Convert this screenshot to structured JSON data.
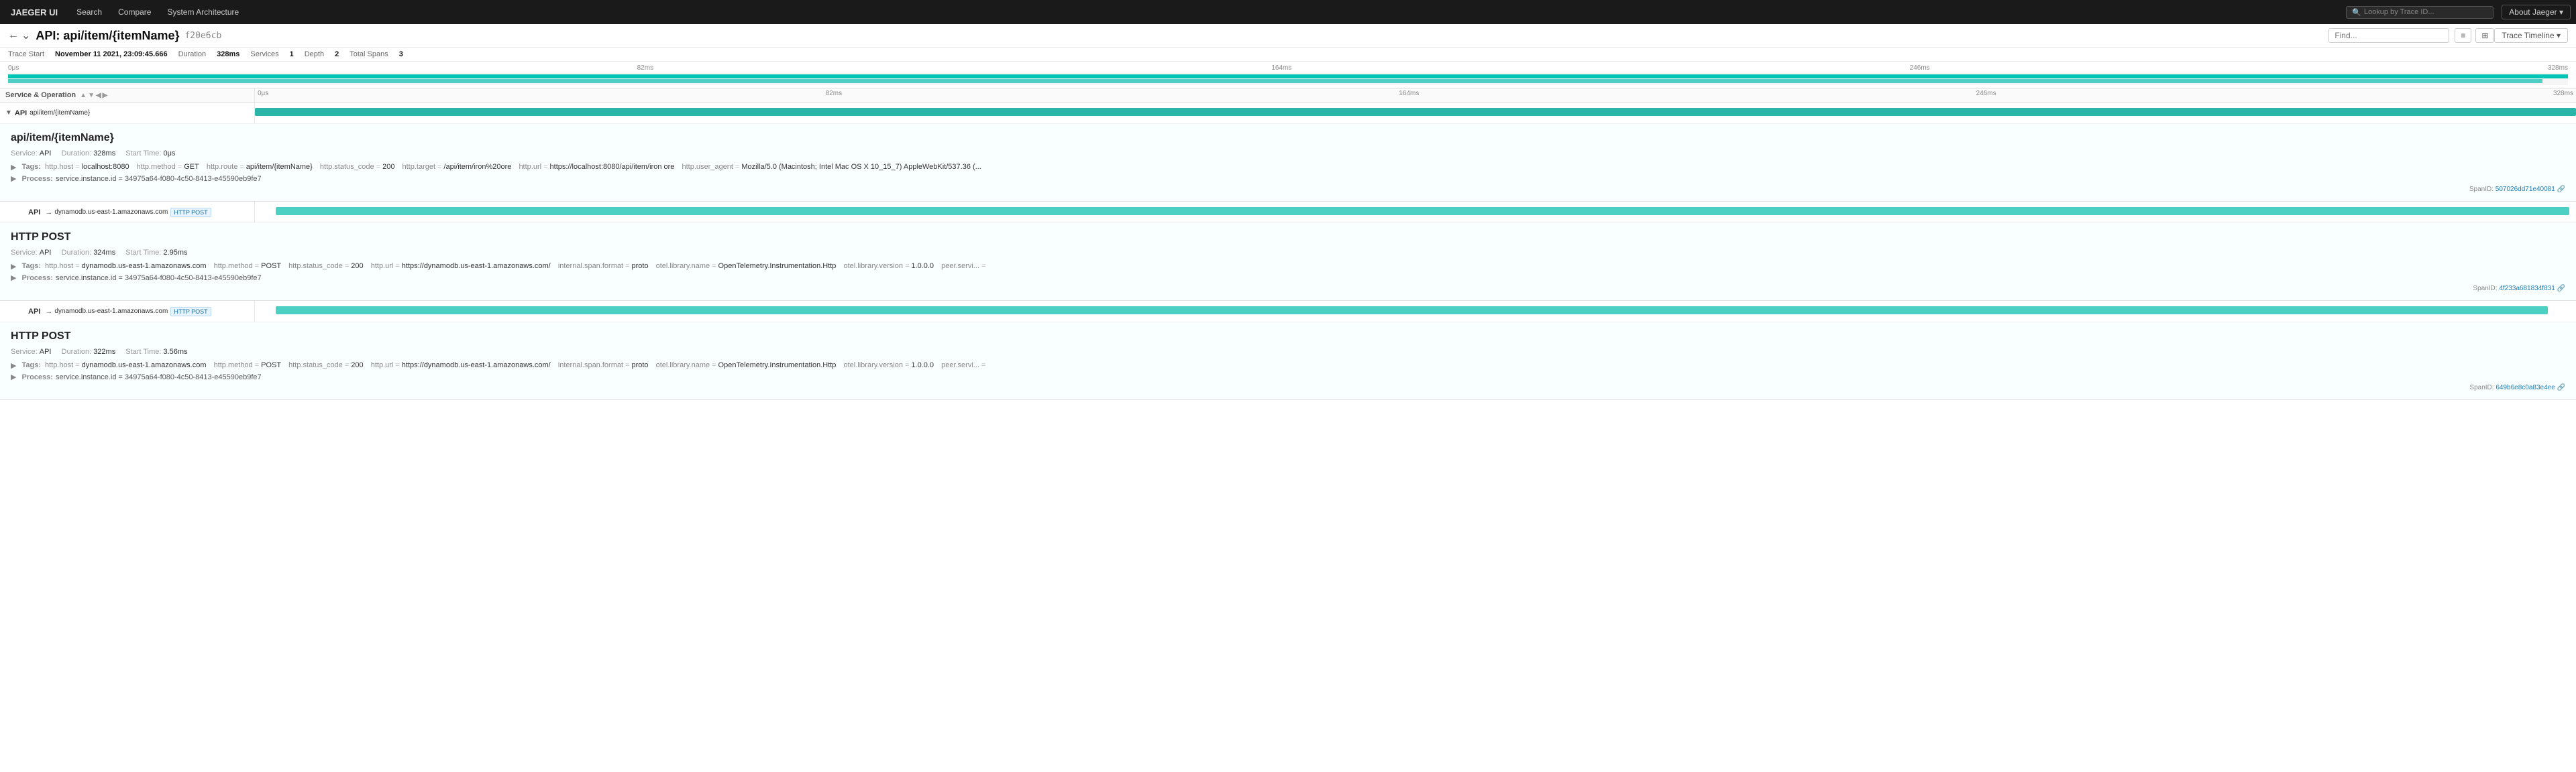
{
  "nav": {
    "logo": "JAEGER UI",
    "buttons": [
      "Search",
      "Compare",
      "System Architecture"
    ],
    "active": "Search",
    "lookup_placeholder": "Lookup by Trace ID...",
    "about_label": "About Jaeger ▾"
  },
  "trace_header": {
    "title": "API: api/item/{itemName}",
    "trace_id": "f20e6cb",
    "find_placeholder": "Find...",
    "timeline_label": "Trace Timeline ▾"
  },
  "trace_meta": {
    "trace_start_label": "Trace Start",
    "trace_start_value": "November 11 2021, 23:09:45.666",
    "duration_label": "Duration",
    "duration_value": "328ms",
    "services_label": "Services",
    "services_value": "1",
    "depth_label": "Depth",
    "depth_value": "2",
    "total_spans_label": "Total Spans",
    "total_spans_value": "3"
  },
  "ruler": {
    "ticks": [
      "0μs",
      "82ms",
      "164ms",
      "246ms",
      "328ms"
    ]
  },
  "column_header": {
    "service_label": "Service & Operation"
  },
  "spans": [
    {
      "id": "span-1",
      "indent": 0,
      "service": "API",
      "operation": "api/item/{itemName}",
      "has_children": true,
      "expanded": true,
      "bar_left_pct": 0,
      "bar_width_pct": 100,
      "is_root": true,
      "detail": {
        "title": "api/item/{itemName}",
        "service_label": "Service:",
        "service_value": "API",
        "duration_label": "Duration:",
        "duration_value": "328ms",
        "start_time_label": "Start Time:",
        "start_time_value": "0μs",
        "tags_label": "Tags:",
        "tags": [
          {
            "key": "http.host",
            "val": "localhost:8080"
          },
          {
            "key": "http.method",
            "val": "GET"
          },
          {
            "key": "http.route",
            "val": "api/item/{itemName}"
          },
          {
            "key": "http.status_code",
            "val": "200"
          },
          {
            "key": "http.target",
            "val": "/api/item/iron%20ore"
          },
          {
            "key": "http.url",
            "val": "https://localhost:8080/api/item/iron ore"
          },
          {
            "key": "http.user_agent",
            "val": "Mozilla/5.0 (Macintosh; Intel Mac OS X 10_15_7) AppleWebKit/537.36 (..."
          }
        ],
        "process_label": "Process:",
        "process_value": "service.instance.id = 34975a64-f080-4c50-8413-e45590eb9fe7",
        "span_id_label": "SpanID:",
        "span_id_value": "507026dd71e40081"
      }
    },
    {
      "id": "span-2",
      "indent": 1,
      "service": "API",
      "arrow": "→",
      "dest": "dynamodb.us-east-1.amazonaws.com",
      "http_badge": "HTTP POST",
      "bar_left_pct": 0.9,
      "bar_width_pct": 98.8,
      "is_root": false,
      "detail": {
        "title": "HTTP POST",
        "service_label": "Service:",
        "service_value": "API",
        "duration_label": "Duration:",
        "duration_value": "324ms",
        "start_time_label": "Start Time:",
        "start_time_value": "2.95ms",
        "tags_label": "Tags:",
        "tags": [
          {
            "key": "http.host",
            "val": "dynamodb.us-east-1.amazonaws.com"
          },
          {
            "key": "http.method",
            "val": "POST"
          },
          {
            "key": "http.status_code",
            "val": "200"
          },
          {
            "key": "http.url",
            "val": "https://dynamodb.us-east-1.amazonaws.com/"
          },
          {
            "key": "internal.span.format",
            "val": "proto"
          },
          {
            "key": "otel.library.name",
            "val": "OpenTelemetry.Instrumentation.Http"
          },
          {
            "key": "otel.library.version",
            "val": "1.0.0.0"
          },
          {
            "key": "peer.servi...",
            "val": ""
          }
        ],
        "process_label": "Process:",
        "process_value": "service.instance.id = 34975a64-f080-4c50-8413-e45590eb9fe7",
        "span_id_label": "SpanID:",
        "span_id_value": "4f233a681834f831"
      }
    },
    {
      "id": "span-3",
      "indent": 1,
      "service": "API",
      "arrow": "→",
      "dest": "dynamodb.us-east-1.amazonaws.com",
      "http_badge": "HTTP POST",
      "bar_left_pct": 0.9,
      "bar_width_pct": 97.9,
      "is_root": false,
      "detail": {
        "title": "HTTP POST",
        "service_label": "Service:",
        "service_value": "API",
        "duration_label": "Duration:",
        "duration_value": "322ms",
        "start_time_label": "Start Time:",
        "start_time_value": "3.56ms",
        "tags_label": "Tags:",
        "tags": [
          {
            "key": "http.host",
            "val": "dynamodb.us-east-1.amazonaws.com"
          },
          {
            "key": "http.method",
            "val": "POST"
          },
          {
            "key": "http.status_code",
            "val": "200"
          },
          {
            "key": "http.url",
            "val": "https://dynamodb.us-east-1.amazonaws.com/"
          },
          {
            "key": "internal.span.format",
            "val": "proto"
          },
          {
            "key": "otel.library.name",
            "val": "OpenTelemetry.Instrumentation.Http"
          },
          {
            "key": "otel.library.version",
            "val": "1.0.0.0"
          },
          {
            "key": "peer.servi...",
            "val": ""
          }
        ],
        "process_label": "Process:",
        "process_value": "service.instance.id = 34975a64-f080-4c50-8413-e45590eb9fe7",
        "span_id_label": "SpanID:",
        "span_id_value": "649b6e8c0a83e4ee"
      }
    }
  ]
}
